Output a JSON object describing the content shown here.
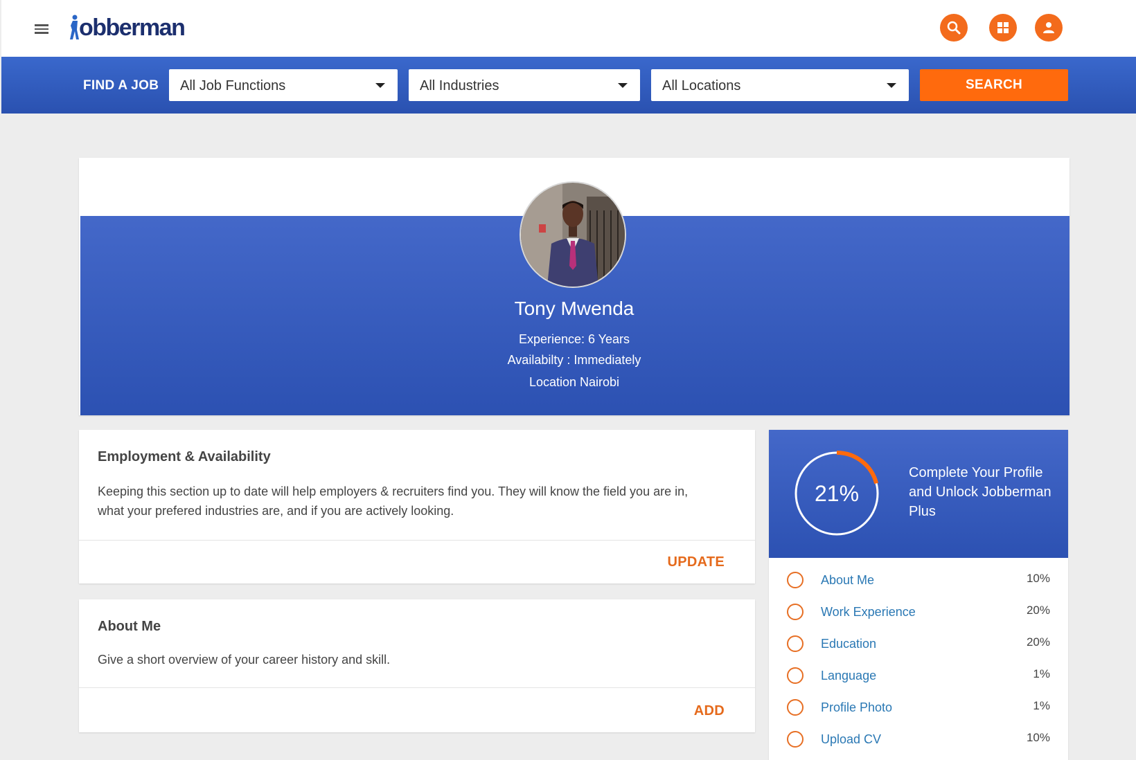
{
  "header": {
    "logo_text": "obberman",
    "icons": [
      "search-icon",
      "dashboard-icon",
      "account-icon"
    ],
    "accent_color": "#f36b1c"
  },
  "search": {
    "label": "FIND A JOB",
    "job_function": "All Job Functions",
    "industry": "All Industries",
    "location": "All Locations",
    "button": "SEARCH",
    "button_color": "#ff6a0d"
  },
  "profile": {
    "name": "Tony Mwenda",
    "experience": "Experience:  6 Years",
    "availability": "Availabilty : Immediately",
    "location": "Location Nairobi",
    "banner_color": "#3a60c2"
  },
  "employment": {
    "title": "Employment & Availability",
    "body_line1": "Keeping this section up to date will help employers & recruiters find you. They will know the field you are in,",
    "body_line2": "what your prefered industries are, and if you are actively looking.",
    "action": "UPDATE"
  },
  "about": {
    "title": "About Me",
    "body": "Give a short overview of your career history and skill.",
    "action": "ADD"
  },
  "completion": {
    "percent_label": "21%",
    "progress": 0.21,
    "cta": "Complete Your Profile and Unlock Jobberman Plus",
    "items": [
      {
        "label": "About Me",
        "pct": "10%"
      },
      {
        "label": "Work Experience",
        "pct": "20%"
      },
      {
        "label": "Education",
        "pct": "20%"
      },
      {
        "label": "Language",
        "pct": "1%"
      },
      {
        "label": "Profile Photo",
        "pct": "1%"
      },
      {
        "label": "Upload CV",
        "pct": "10%"
      }
    ]
  }
}
